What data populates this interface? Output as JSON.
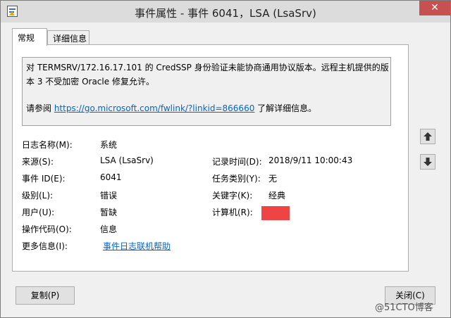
{
  "window": {
    "title": "事件属性 - 事件 6041，LSA (LsaSrv)",
    "close_glyph": "✕"
  },
  "tabs": [
    {
      "label": "常规",
      "active": true
    },
    {
      "label": "详细信息",
      "active": false
    }
  ],
  "description": {
    "text": "对 TERMSRV/172.16.17.101 的 CredSSP 身份验证未能协商通用协议版本。远程主机提供的版本 3 不受加密 Oracle 修复允许。",
    "see_prefix": "请参阅 ",
    "link": "https://go.microsoft.com/fwlink/?linkid=866660",
    "see_suffix": " 了解详细信息。"
  },
  "fields": {
    "log_name": {
      "label": "日志名称(M):",
      "value": "系统"
    },
    "source": {
      "label": "来源(S):",
      "value": "LSA (LsaSrv)"
    },
    "logged": {
      "label": "记录时间(D):",
      "value": "2018/9/11 10:00:43"
    },
    "event_id": {
      "label": "事件 ID(E):",
      "value": "6041"
    },
    "task_category": {
      "label": "任务类别(Y):",
      "value": "无"
    },
    "level": {
      "label": "级别(L):",
      "value": "错误"
    },
    "keywords": {
      "label": "关键字(K):",
      "value": "经典"
    },
    "user": {
      "label": "用户(U):",
      "value": "暂缺"
    },
    "computer": {
      "label": "计算机(R):",
      "value": ""
    },
    "opcode": {
      "label": "操作代码(O):",
      "value": "信息"
    },
    "more_info": {
      "label": "更多信息(I):",
      "value": "事件日志联机帮助"
    }
  },
  "buttons": {
    "copy": "复制(P)",
    "close": "关闭(C)"
  },
  "watermark": "@51CTO博客",
  "colors": {
    "link": "#0066cc",
    "redaction": "#ef4444",
    "close_button": "#c75050"
  }
}
